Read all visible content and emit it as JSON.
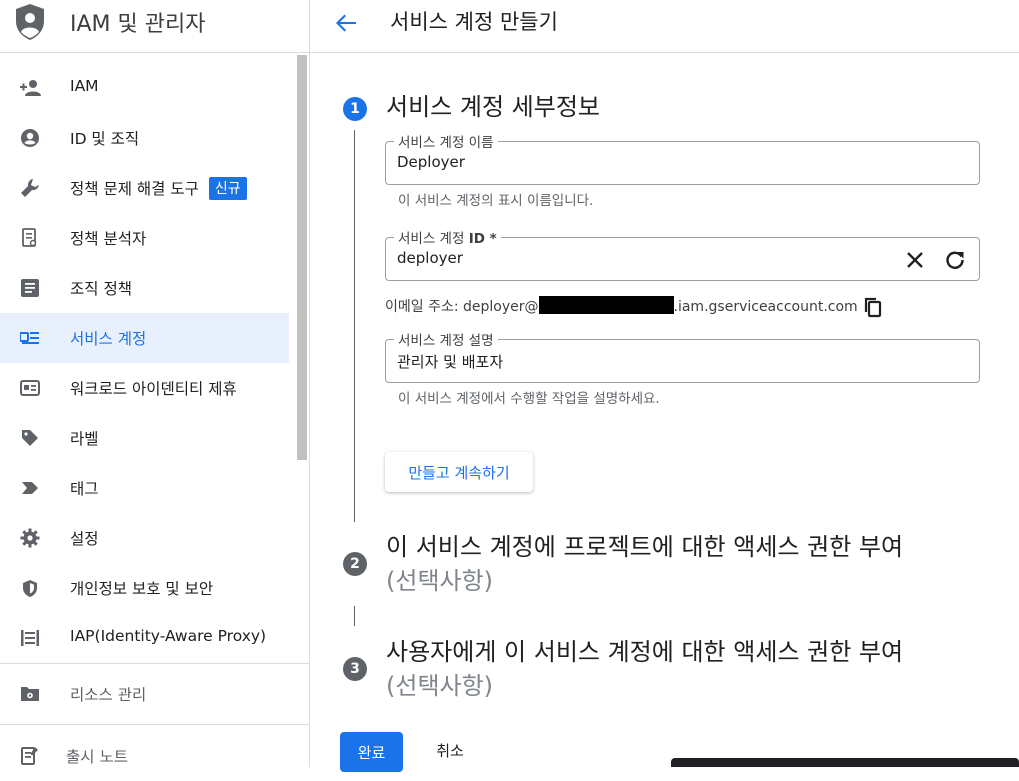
{
  "sidebar": {
    "title": "IAM 및 관리자",
    "items": [
      {
        "label": "IAM",
        "icon": "person-add-icon"
      },
      {
        "label": "ID 및 조직",
        "icon": "account-circle-icon"
      },
      {
        "label": "정책 문제 해결 도구",
        "icon": "wrench-icon",
        "badge": "신규"
      },
      {
        "label": "정책 분석자",
        "icon": "document-search-icon"
      },
      {
        "label": "조직 정책",
        "icon": "article-icon"
      },
      {
        "label": "서비스 계정",
        "icon": "service-account-icon",
        "active": true
      },
      {
        "label": "워크로드 아이덴티티 제휴",
        "icon": "id-card-icon"
      },
      {
        "label": "라벨",
        "icon": "label-icon"
      },
      {
        "label": "태그",
        "icon": "tag-icon"
      },
      {
        "label": "설정",
        "icon": "gear-icon"
      },
      {
        "label": "개인정보 보호 및 보안",
        "icon": "shield-icon"
      },
      {
        "label": "IAP(Identity-Aware Proxy)",
        "icon": "iap-icon"
      }
    ],
    "manage_resources": {
      "label": "리소스 관리",
      "icon": "folder-gear-icon"
    },
    "release_notes": {
      "label": "출시 노트",
      "icon": "release-notes-icon"
    }
  },
  "header": {
    "title": "서비스 계정 만들기"
  },
  "steps": [
    {
      "number": "1",
      "title": "서비스 계정 세부정보",
      "subtitle": ""
    },
    {
      "number": "2",
      "title": "이 서비스 계정에 프로젝트에 대한 액세스 권한 부여",
      "subtitle": "(선택사항)"
    },
    {
      "number": "3",
      "title": "사용자에게 이 서비스 계정에 대한 액세스 권한 부여",
      "subtitle": "(선택사항)"
    }
  ],
  "form": {
    "name": {
      "label": "서비스 계정 이름",
      "value": "Deployer",
      "hint": "이 서비스 계정의 표시 이름입니다."
    },
    "id": {
      "label": "서비스 계정 ",
      "label_bold": "ID *",
      "value": "deployer"
    },
    "email": {
      "prefix": "이메일 주소: deployer@",
      "suffix": ".iam.gserviceaccount.com"
    },
    "description": {
      "label": "서비스 계정 설명",
      "value": "관리자 및 배포자",
      "hint": "이 서비스 계정에서 수행할 작업을 설명하세요."
    },
    "continue_label": "만들고 계속하기"
  },
  "actions": {
    "done_label": "완료",
    "cancel_label": "취소"
  },
  "colors": {
    "accent": "#1a73e8",
    "step_active": "#1a73e8",
    "step_inactive": "#5f6368",
    "active_nav_bg": "#e8f0fe"
  }
}
